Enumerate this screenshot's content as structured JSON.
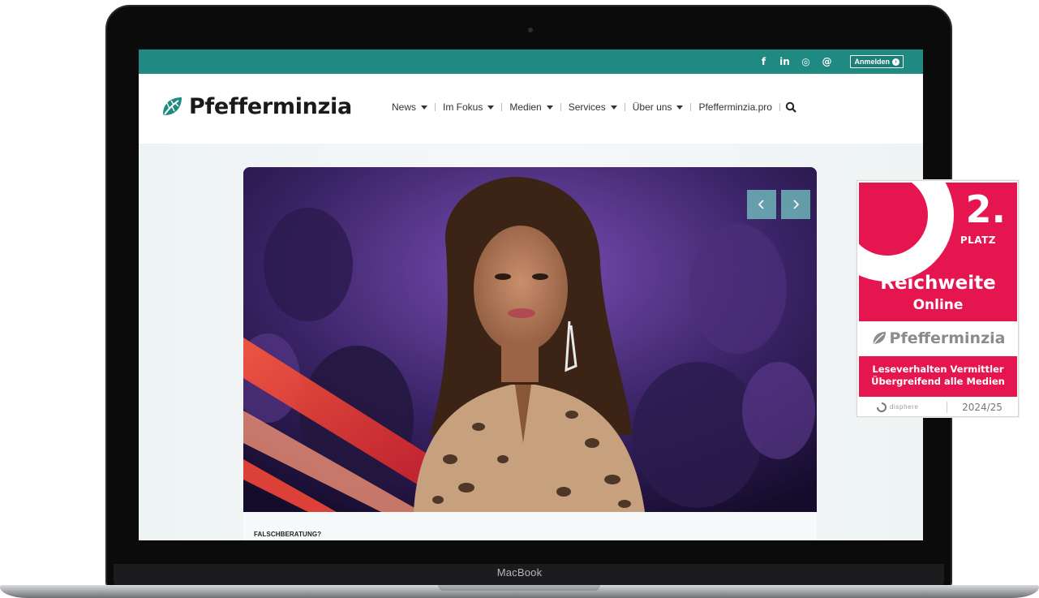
{
  "device": {
    "label": "MacBook"
  },
  "website": {
    "topbar": {
      "social_icons": [
        "facebook-icon",
        "linkedin-icon",
        "instagram-icon",
        "threads-icon"
      ],
      "social_glyphs": [
        "f",
        "in",
        "◎",
        "@"
      ],
      "login_label": "Anmelden"
    },
    "header": {
      "logo_text": "Pfefferminzia",
      "nav": [
        {
          "label": "News",
          "dropdown": true
        },
        {
          "label": "Im Fokus",
          "dropdown": true
        },
        {
          "label": "Medien",
          "dropdown": true
        },
        {
          "label": "Services",
          "dropdown": true
        },
        {
          "label": "Über uns",
          "dropdown": true
        },
        {
          "label": "Pfefferminzia.pro",
          "dropdown": false
        }
      ]
    },
    "hero": {
      "kicker": "FALSCHBERATUNG?",
      "prev_icon": "chevron-left-icon",
      "next_icon": "chevron-right-icon"
    }
  },
  "badge": {
    "place": "2.",
    "place_label": "PLATZ",
    "title": "Reichweite",
    "subtitle": "Online",
    "logo_text": "Pfefferminzia",
    "line1": "Leseverhalten Vermittler",
    "line2": "Übergreifend alle Medien",
    "brand": "disphere",
    "year": "2024/25"
  },
  "colors": {
    "teal": "#1e8a82",
    "badge_pink": "#e5154f",
    "logo_green": "#1e8a82"
  }
}
